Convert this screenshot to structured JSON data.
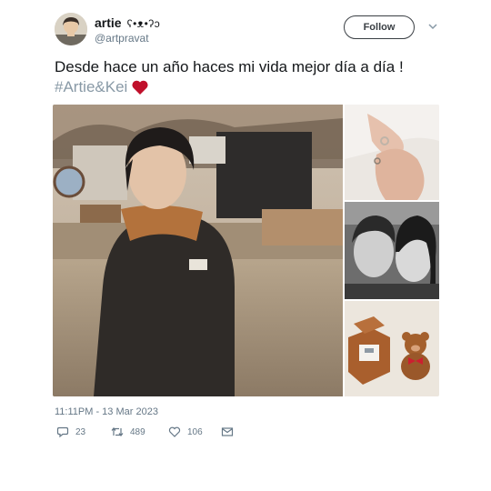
{
  "tweet": {
    "author": {
      "display_name": "artie",
      "name_decoration": "ʕ•ᴥ•ʔↄ",
      "handle": "@artpravat"
    },
    "follow_label": "Follow",
    "text": "Desde hace un año haces mi vida mejor día a día !",
    "hashtag": "#Artie&Kei",
    "timestamp": "11:11PM - 13 Mar 2023",
    "actions": {
      "replies": "23",
      "retweets": "489",
      "likes": "106"
    },
    "colors": {
      "text": "#14171a",
      "muted": "#657786",
      "hashtag": "#8899a6",
      "heart": "#c0102b"
    },
    "icons": [
      "chevron-down-icon",
      "heart-icon",
      "reply-icon",
      "retweet-icon",
      "like-icon",
      "message-icon"
    ],
    "media_alt": {
      "main": "Photo of a person in a dark jacket with orange fur collar on a road",
      "top_right": "Two hands with rings",
      "middle_right": "Black-and-white selfie of two people",
      "bottom_right": "Ring box and small teddy bear"
    }
  }
}
